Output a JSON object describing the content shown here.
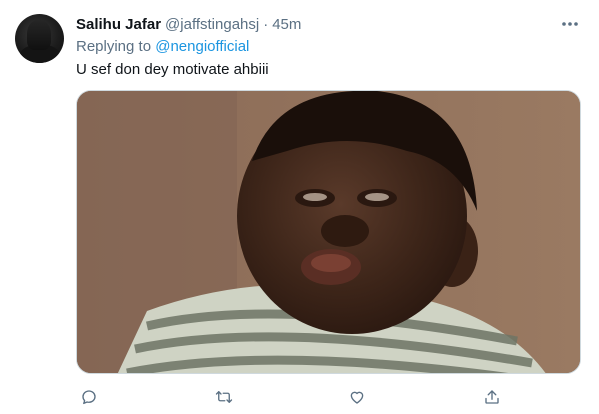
{
  "tweet": {
    "author_name": "Salihu Jafar",
    "handle": "@jaffstingahsj",
    "separator": "·",
    "time": "45m",
    "replying_prefix": "Replying to",
    "replying_to": "@nengiofficial",
    "text": "U sef don dey motivate ahbiii"
  },
  "icons": {
    "more": "more-icon",
    "reply": "reply-icon",
    "retweet": "retweet-icon",
    "like": "like-icon",
    "share": "share-icon"
  },
  "colors": {
    "text_primary": "#0f1419",
    "text_secondary": "#5b7083",
    "link": "#1b95e0",
    "border": "#cfd9de"
  }
}
